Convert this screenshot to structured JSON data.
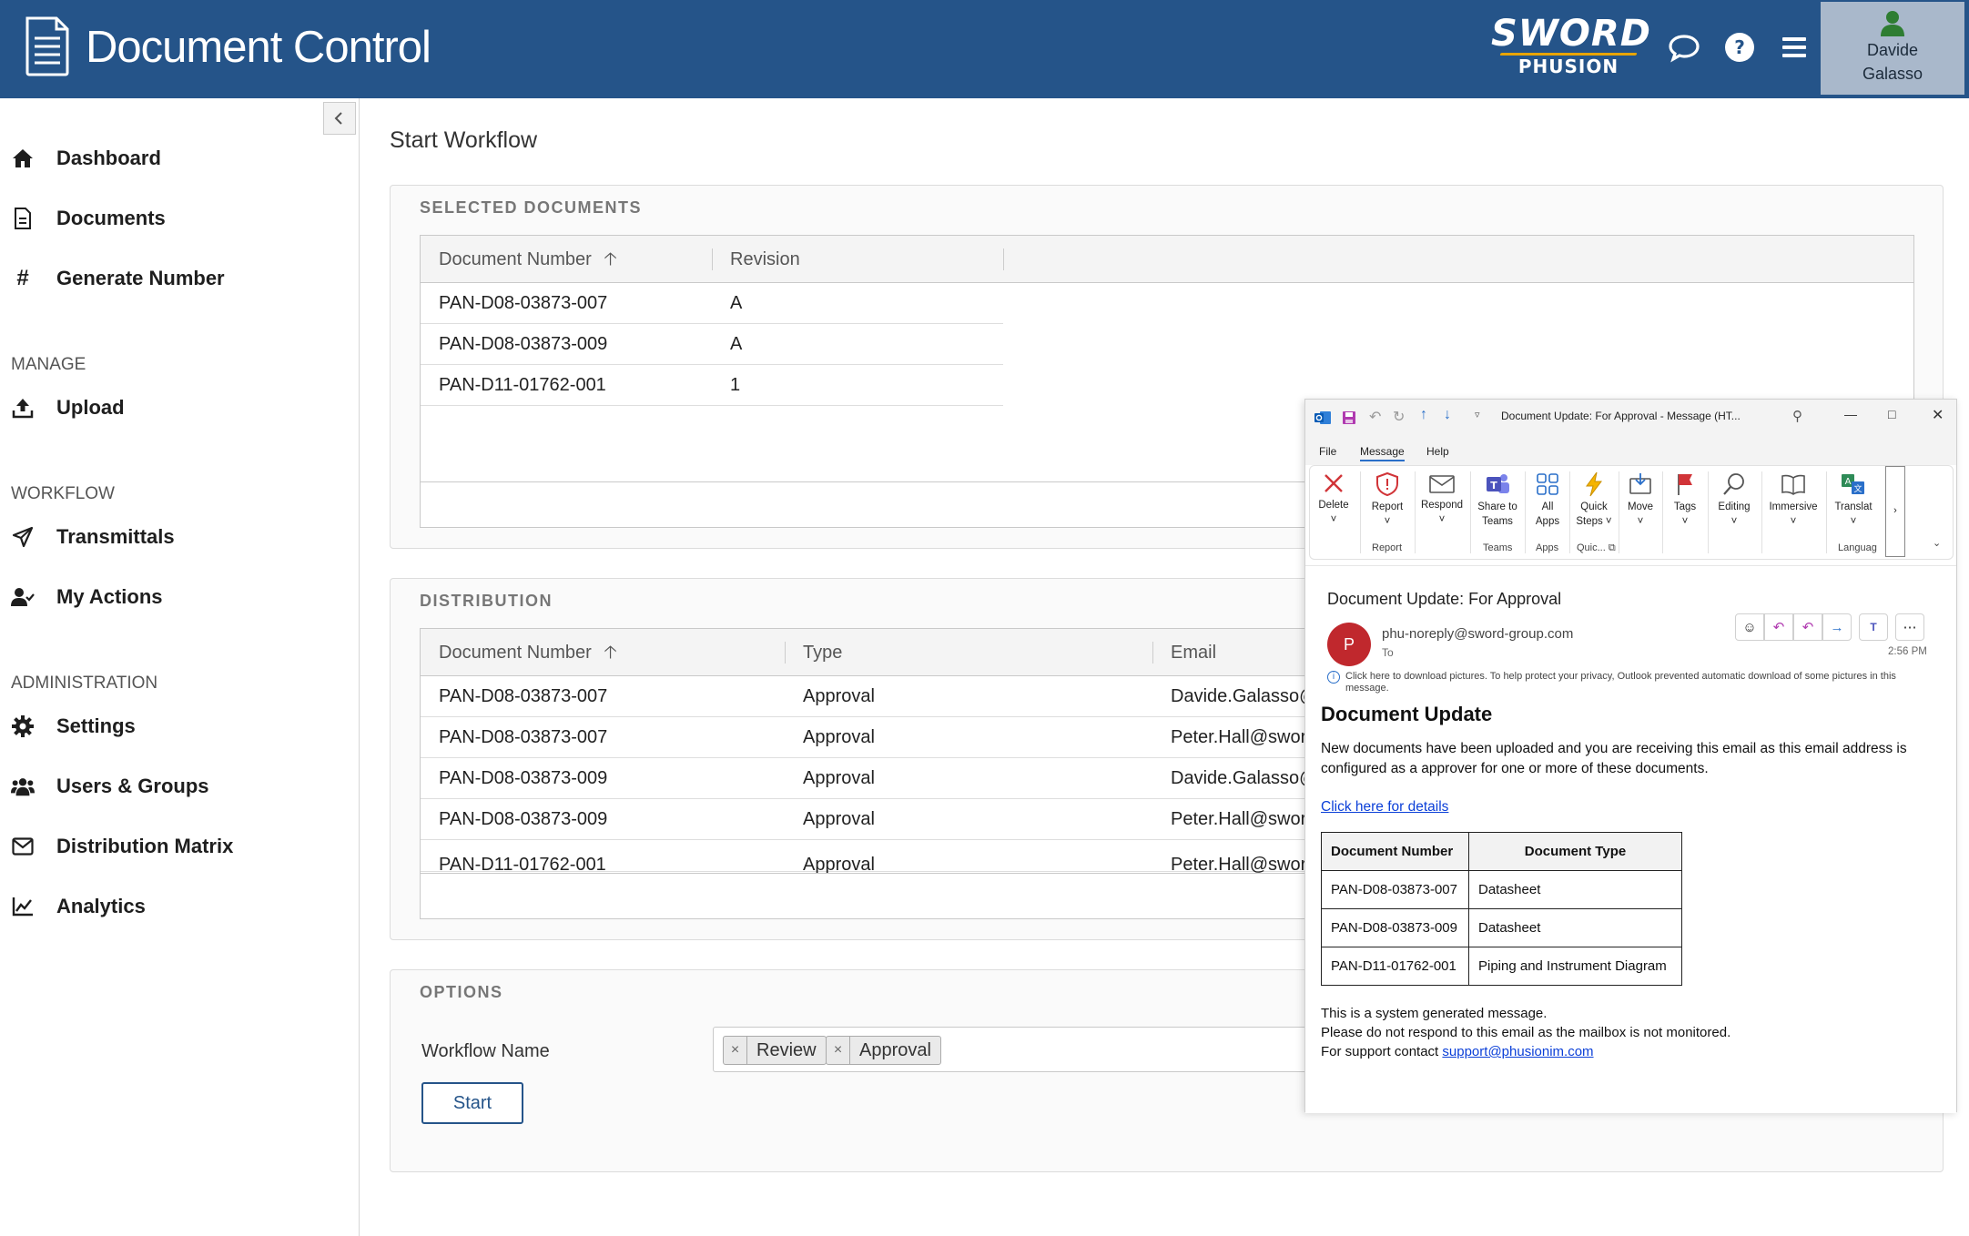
{
  "header": {
    "app_title": "Document Control",
    "brand_top": "SWORD",
    "brand_bottom": "PHUSION",
    "user_first": "Davide",
    "user_last": "Galasso"
  },
  "sidebar": {
    "items_top": [
      {
        "label": "Dashboard",
        "icon": "home-icon"
      },
      {
        "label": "Documents",
        "icon": "document-icon"
      },
      {
        "label": "Generate Number",
        "icon": "hash-icon"
      }
    ],
    "manage_title": "MANAGE",
    "manage_items": [
      {
        "label": "Upload",
        "icon": "upload-icon"
      }
    ],
    "workflow_title": "WORKFLOW",
    "workflow_items": [
      {
        "label": "Transmittals",
        "icon": "send-icon"
      },
      {
        "label": "My Actions",
        "icon": "user-check-icon"
      }
    ],
    "admin_title": "ADMINISTRATION",
    "admin_items": [
      {
        "label": "Settings",
        "icon": "gear-icon"
      },
      {
        "label": "Users & Groups",
        "icon": "users-icon"
      },
      {
        "label": "Distribution Matrix",
        "icon": "envelope-icon"
      },
      {
        "label": "Analytics",
        "icon": "chart-icon"
      }
    ]
  },
  "main": {
    "page_title": "Start Workflow",
    "selected": {
      "title": "SELECTED DOCUMENTS",
      "columns": [
        "Document Number",
        "Revision"
      ],
      "rows": [
        [
          "PAN-D08-03873-007",
          "A"
        ],
        [
          "PAN-D08-03873-009",
          "A"
        ],
        [
          "PAN-D11-01762-001",
          "1"
        ]
      ]
    },
    "distribution": {
      "title": "DISTRIBUTION",
      "columns": [
        "Document Number",
        "Type",
        "Email"
      ],
      "rows": [
        [
          "PAN-D08-03873-007",
          "Approval",
          "Davide.Galasso@"
        ],
        [
          "PAN-D08-03873-007",
          "Approval",
          "Peter.Hall@sworc"
        ],
        [
          "PAN-D08-03873-009",
          "Approval",
          "Davide.Galasso@"
        ],
        [
          "PAN-D08-03873-009",
          "Approval",
          "Peter.Hall@sworc"
        ],
        [
          "PAN-D11-01762-001",
          "Approval",
          "Peter.Hall@sworc"
        ]
      ]
    },
    "options": {
      "title": "OPTIONS",
      "workflow_label": "Workflow Name",
      "tags": [
        "Review",
        "Approval"
      ],
      "tag_remove": "×",
      "start_label": "Start"
    }
  },
  "outlook": {
    "window_title": "Document Update: For Approval  -  Message (HT...",
    "menu": [
      "File",
      "Message",
      "Help"
    ],
    "ribbon": {
      "delete": "Delete",
      "report": "Report",
      "respond": "Respond",
      "share1": "Share to",
      "share2": "Teams",
      "allapps1": "All",
      "allapps2": "Apps",
      "quick1": "Quick",
      "quick2": "Steps ˅",
      "move": "Move",
      "tags": "Tags",
      "editing": "Editing",
      "immersive": "Immersive",
      "translate": "Translat",
      "g_report": "Report",
      "g_teams": "Teams",
      "g_apps": "Apps",
      "g_quick": "Quic... ⧉",
      "g_lang": "Languag"
    },
    "subject": "Document Update: For Approval",
    "avatar_letter": "P",
    "from": "phu-noreply@sword-group.com",
    "to": "To",
    "time": "2:56 PM",
    "privacy": "Click here to download pictures. To help protect your privacy, Outlook prevented automatic download of some pictures in this message.",
    "heading": "Document Update",
    "paragraph": "New documents have been uploaded and you are receiving this email as this email address is configured as a approver for one or more of these documents.",
    "link": "Click here for details",
    "table_headers": [
      "Document Number",
      "Document Type"
    ],
    "table_rows": [
      [
        "PAN-D08-03873-007",
        "Datasheet"
      ],
      [
        "PAN-D08-03873-009",
        "Datasheet"
      ],
      [
        "PAN-D11-01762-001",
        "Piping and Instrument Diagram"
      ]
    ],
    "footer1": "This is a system generated message.",
    "footer2": "Please do not respond to this email as the mailbox is not monitored.",
    "footer3": "For support contact ",
    "support_email": "support@phusionim.com"
  }
}
